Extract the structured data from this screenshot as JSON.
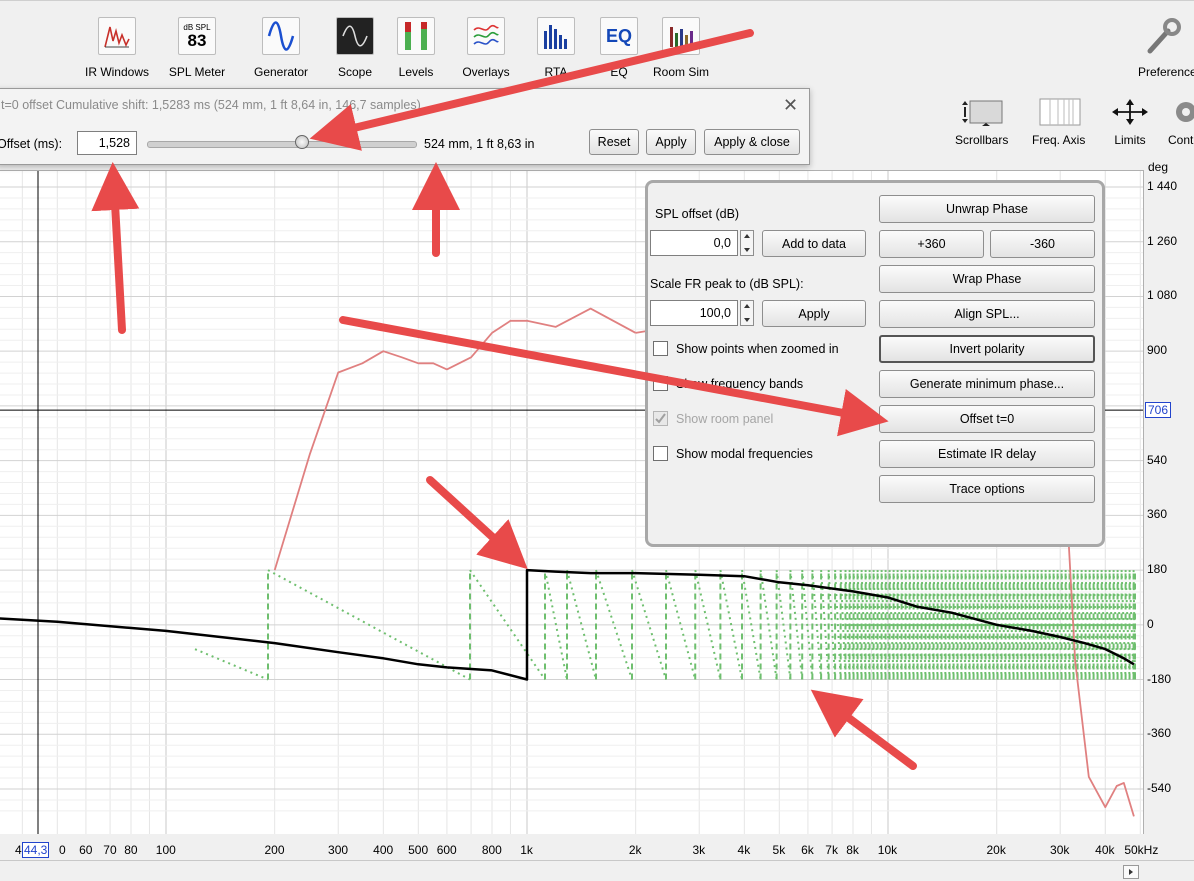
{
  "toolbar": {
    "items": [
      {
        "label": "IR Windows",
        "icon": "ir-windows-icon"
      },
      {
        "label": "SPL Meter",
        "icon": "spl-meter-icon",
        "badge_top": "dB SPL",
        "badge_value": "83"
      },
      {
        "label": "Generator",
        "icon": "generator-icon"
      },
      {
        "label": "Scope",
        "icon": "scope-icon"
      },
      {
        "label": "Levels",
        "icon": "levels-icon"
      },
      {
        "label": "Overlays",
        "icon": "overlays-icon"
      },
      {
        "label": "RTA",
        "icon": "rta-icon"
      },
      {
        "label": "EQ",
        "icon": "eq-icon",
        "badge_value": "EQ"
      },
      {
        "label": "Room Sim",
        "icon": "room-sim-icon"
      }
    ],
    "preferences_label": "Preferences",
    "right_items": [
      {
        "label": "Scrollbars",
        "icon": "scrollbars-icon"
      },
      {
        "label": "Freq. Axis",
        "icon": "freq-axis-icon"
      },
      {
        "label": "Limits",
        "icon": "limits-icon"
      },
      {
        "label": "Controls",
        "icon": "controls-icon"
      }
    ]
  },
  "offset_dialog": {
    "title": "t=0 offset  Cumulative shift: 1,5283 ms (524 mm, 1 ft 8,64 in, 146,7 samples)",
    "offset_label": "Offset (ms):",
    "offset_value": "1,528",
    "slider_position": 0.58,
    "distance_text": "524 mm, 1 ft 8,63 in",
    "reset_label": "Reset",
    "apply_label": "Apply",
    "apply_close_label": "Apply & close"
  },
  "controls_panel": {
    "spl_offset_label": "SPL offset (dB)",
    "spl_offset_value": "0,0",
    "add_to_data_label": "Add to data",
    "scale_fr_label": "Scale FR peak to (dB SPL):",
    "scale_fr_value": "100,0",
    "scale_apply_label": "Apply",
    "checkboxes": [
      {
        "label": "Show points when zoomed in",
        "checked": false,
        "disabled": false
      },
      {
        "label": "Show frequency bands",
        "checked": false,
        "disabled": false
      },
      {
        "label": "Show room panel",
        "checked": true,
        "disabled": true
      },
      {
        "label": "Show modal frequencies",
        "checked": false,
        "disabled": false
      }
    ],
    "buttons": {
      "unwrap_phase": "Unwrap Phase",
      "plus360": "+360",
      "minus360": "-360",
      "wrap_phase": "Wrap Phase",
      "align_spl": "Align SPL...",
      "invert_polarity": "Invert polarity",
      "generate_min_phase": "Generate minimum phase...",
      "offset_t0": "Offset t=0",
      "estimate_ir_delay": "Estimate IR delay",
      "trace_options": "Trace options"
    }
  },
  "chart_data": {
    "type": "line",
    "x_scale": "log",
    "y_unit": "deg",
    "x_ticks": [
      "60",
      "70",
      "80",
      "100",
      "200",
      "300",
      "400",
      "500",
      "600",
      "800",
      "1k",
      "2k",
      "3k",
      "4k",
      "5k",
      "6k",
      "7k",
      "8k",
      "10k",
      "20k",
      "30k",
      "40k",
      "50kHz"
    ],
    "x_cursor_readout": "44,3",
    "x_tick_partial": "4",
    "x_tick_partial_after": "0",
    "y_ticks": [
      "1 440",
      "1 260",
      "1 080",
      "900",
      "540",
      "360",
      "180",
      "0",
      "-180",
      "-360",
      "-540"
    ],
    "y_cursor_readout": "706",
    "ylim": [
      -630,
      1440
    ],
    "series": [
      {
        "color": "#e08080",
        "x": [
          200,
          250,
          300,
          350,
          400,
          450,
          500,
          550,
          600,
          700,
          800,
          900,
          1000,
          1200,
          1500,
          2000
        ],
        "values": [
          180,
          560,
          830,
          860,
          900,
          880,
          860,
          860,
          840,
          880,
          960,
          1000,
          1000,
          980,
          1040,
          960
        ]
      },
      {
        "color": "#e08080",
        "x": [
          2000,
          4000,
          6000,
          8000,
          10000,
          15000,
          20000,
          22000,
          25000,
          28000,
          30000,
          33000,
          36000,
          40000,
          43000,
          45000,
          48000
        ],
        "values": [
          960,
          1020,
          1060,
          1000,
          1000,
          960,
          900,
          600,
          900,
          500,
          780,
          -120,
          -500,
          -600,
          -530,
          -520,
          -630
        ]
      },
      {
        "color": "#000000",
        "x": [
          30,
          50,
          100,
          200,
          300,
          400,
          500,
          600,
          800,
          1000,
          1000,
          1200,
          1500,
          2000,
          3000,
          4000,
          5000,
          6000,
          8000,
          10000,
          12000,
          15000,
          20000,
          25000,
          30000,
          35000,
          40000,
          45000,
          48000
        ],
        "values": [
          25,
          10,
          -20,
          -60,
          -90,
          -110,
          -130,
          -140,
          -150,
          -180,
          180,
          175,
          170,
          170,
          165,
          160,
          140,
          130,
          110,
          90,
          60,
          40,
          0,
          -20,
          -40,
          -60,
          -80,
          -110,
          -130
        ]
      }
    ],
    "wrapped_phase_color": "#6fbf6f"
  },
  "annotations": {
    "arrow_color": "#e84a4a"
  }
}
